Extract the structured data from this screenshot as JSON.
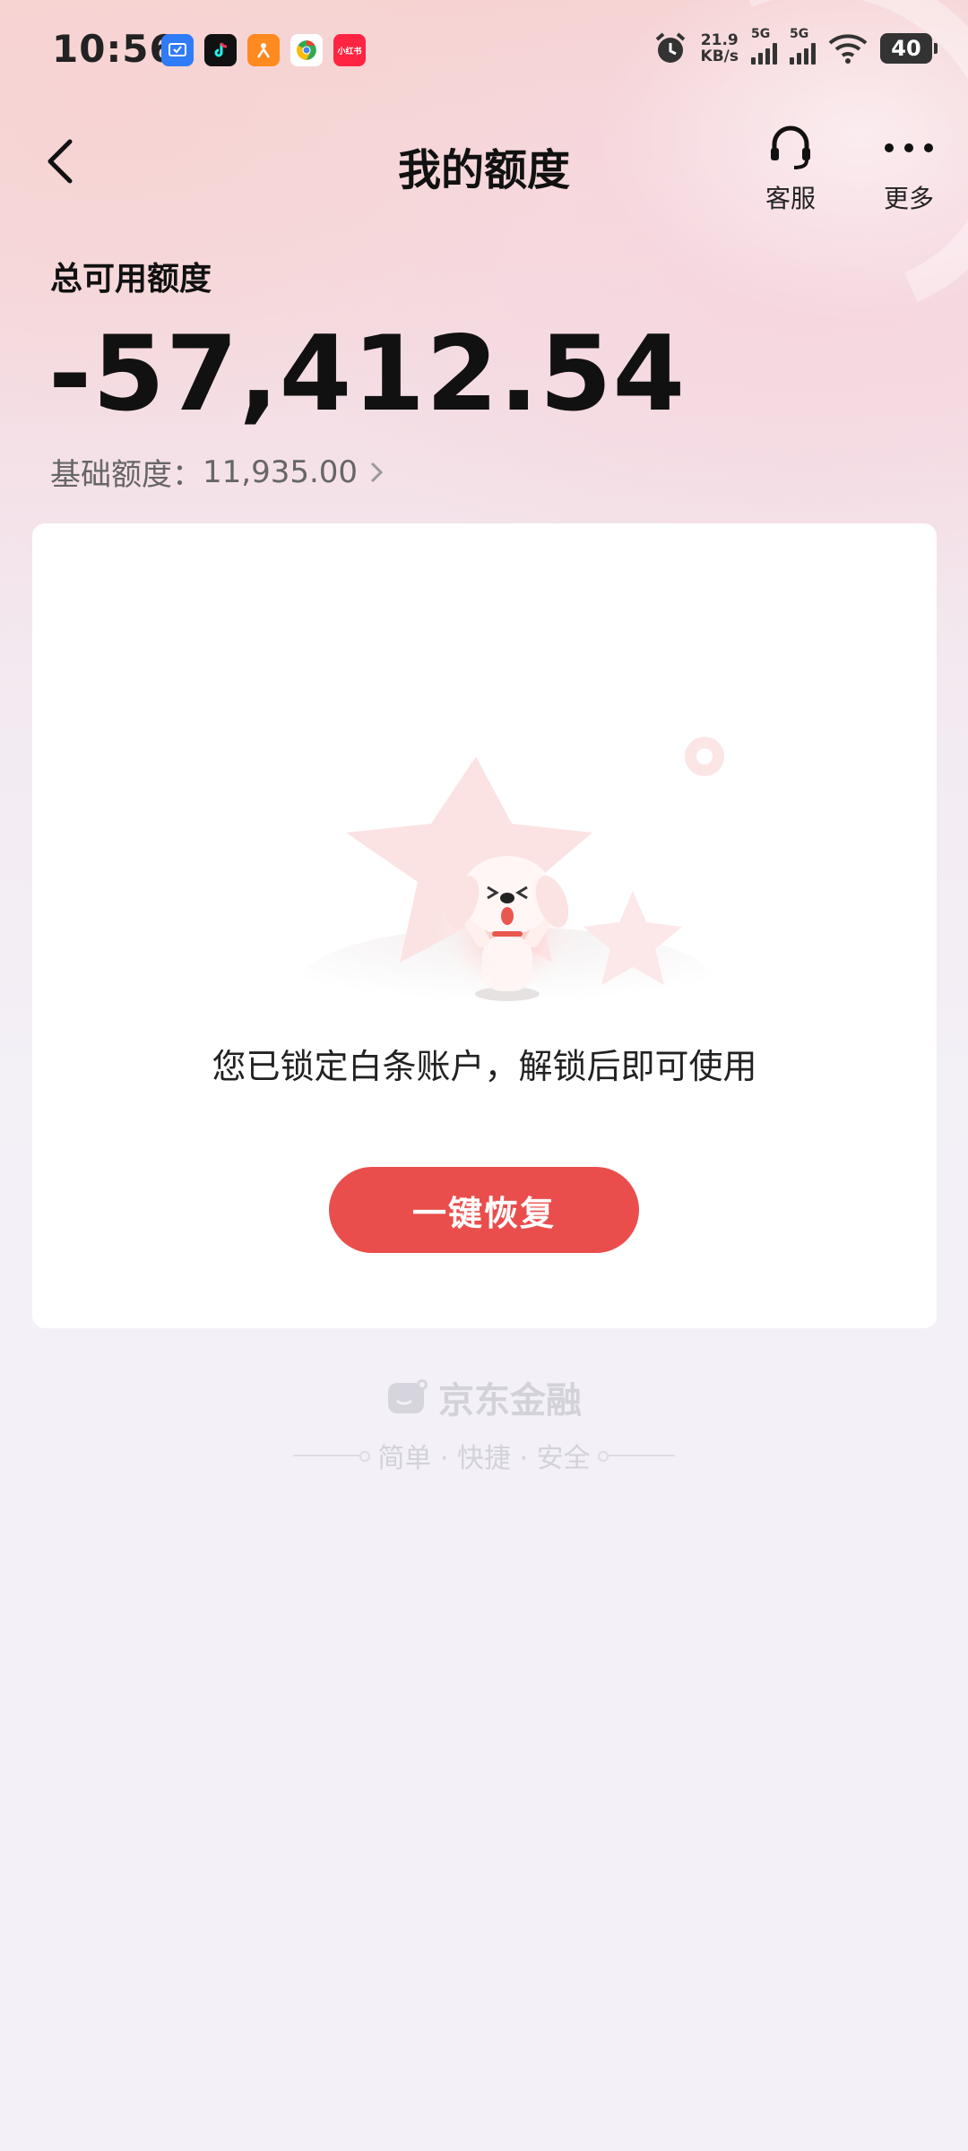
{
  "status_bar": {
    "time": "10:56",
    "net_speed_value": "21.9",
    "net_speed_unit": "KB/s",
    "signal_1_label": "5G",
    "signal_2_label": "5G",
    "battery": "40",
    "notification_icons": [
      "message-app-icon",
      "douyin-icon",
      "taobao-icon",
      "chrome-icon",
      "xiaohongshu-icon"
    ],
    "xiaohongshu_text": "小红书"
  },
  "nav": {
    "title": "我的额度",
    "service_label": "客服",
    "more_label": "更多"
  },
  "quota": {
    "total_label": "总可用额度",
    "total_value": "-57,412.54",
    "base_label": "基础额度：",
    "base_value": "11,935.00"
  },
  "card": {
    "message": "您已锁定白条账户，解锁后即可使用",
    "restore_button": "一键恢复"
  },
  "footer": {
    "brand_name": "京东金融",
    "slogan": "简单 · 快捷 · 安全"
  },
  "colors": {
    "accent_red": "#e94e4c",
    "background": "#f3f1f7"
  }
}
